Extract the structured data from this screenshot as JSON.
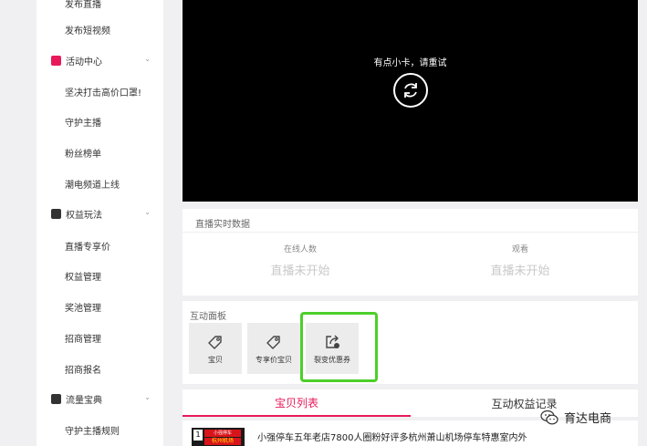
{
  "sidebar": {
    "top_cut": "发布直播",
    "items": [
      {
        "type": "sub",
        "label": "发布短视频"
      },
      {
        "type": "group",
        "label": "活动中心",
        "icon": "gift-icon",
        "color": "#e8195a"
      },
      {
        "type": "sub",
        "label": "坚决打击高价口罩!"
      },
      {
        "type": "sub",
        "label": "守护主播"
      },
      {
        "type": "sub",
        "label": "粉丝榜单"
      },
      {
        "type": "sub",
        "label": "潮电频道上线"
      },
      {
        "type": "group",
        "label": "权益玩法",
        "icon": "wallet-icon",
        "color": "#333333"
      },
      {
        "type": "sub",
        "label": "直播专享价"
      },
      {
        "type": "sub",
        "label": "权益管理"
      },
      {
        "type": "sub",
        "label": "奖池管理"
      },
      {
        "type": "sub",
        "label": "招商管理"
      },
      {
        "type": "sub",
        "label": "招商报名"
      },
      {
        "type": "group",
        "label": "流量宝典",
        "icon": "chart-icon",
        "color": "#333333"
      },
      {
        "type": "sub",
        "label": "守护主播规则"
      }
    ]
  },
  "video": {
    "message": "有点小卡，请重试",
    "reload_icon": "reload-icon"
  },
  "realtime": {
    "title": "直播实时数据",
    "online_label": "在线人数",
    "online_value": "直播未开始",
    "viewers_label": "观看",
    "viewers_value": "直播未开始"
  },
  "interactive": {
    "title": "互动面板",
    "tiles": [
      {
        "label": "宝贝",
        "icon": "tag-icon"
      },
      {
        "label": "专享价宝贝",
        "icon": "tag-icon"
      },
      {
        "label": "裂变优惠券",
        "icon": "share-coupon-icon"
      }
    ]
  },
  "tabs": {
    "active": "宝贝列表",
    "other": "互动权益记录"
  },
  "product": {
    "index": "1",
    "thumb_tag": "小强停车",
    "thumb_tag2": "杭州机场",
    "title": "小强停车五年老店7800人圈粉好评多杭州萧山机场停车特惠室内外"
  },
  "watermark": {
    "text": "育达电商"
  },
  "colors": {
    "accent": "#e8195a",
    "highlight": "#4ccf2a"
  }
}
